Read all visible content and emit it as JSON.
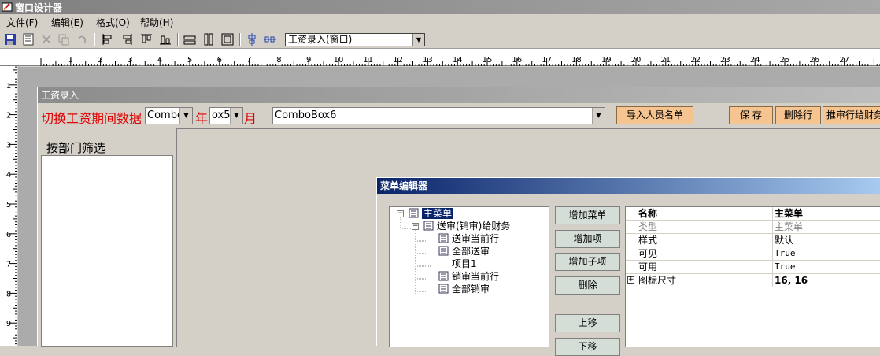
{
  "app": {
    "title": "窗口设计器"
  },
  "menubar": [
    "文件(F)",
    "编辑(E)",
    "格式(O)",
    "帮助(H)"
  ],
  "toolbar": {
    "icons": [
      "save-icon",
      "save-all-icon",
      "cut-icon",
      "copy-icon",
      "undo-icon",
      "align-left-icon",
      "align-right-icon",
      "align-top-icon",
      "align-bottom-icon",
      "same-width-icon",
      "same-height-icon",
      "same-size-icon",
      "center-vertical-icon",
      "center-horizontal-icon"
    ],
    "window_select_value": "工资录入(窗口)"
  },
  "ruler": {
    "h_labels": [
      "1",
      "2",
      "3",
      "4",
      "5",
      "6",
      "7",
      "8",
      "9",
      "10",
      "11",
      "12",
      "13",
      "14",
      "15",
      "16",
      "17",
      "18",
      "19",
      "20",
      "21",
      "22",
      "23",
      "24",
      "25",
      "26",
      "27"
    ],
    "v_labels": [
      "1",
      "2",
      "3",
      "4",
      "5",
      "6",
      "7",
      "8",
      "9"
    ]
  },
  "form": {
    "title": "工资录入",
    "period_label": "切换工资期间数据",
    "combo_year": "Combo",
    "year_label": "年",
    "combo_month": "ox5",
    "month_label": "月",
    "combo6": "ComboBox6",
    "import_button": "导入人员名单",
    "save_button": "保 存",
    "delete_row_button": "删除行",
    "push_button": "推审行给财务",
    "dept_filter_label": "按部门筛选"
  },
  "menu_editor": {
    "title": "菜单编辑器",
    "tree": [
      {
        "label": "主菜单",
        "selected": true
      },
      {
        "label": "送审(销审)给财务"
      },
      {
        "label": "送审当前行"
      },
      {
        "label": "全部送审"
      },
      {
        "label": "项目1"
      },
      {
        "label": "销审当前行"
      },
      {
        "label": "全部销审"
      }
    ],
    "buttons": [
      "增加菜单",
      "增加项",
      "增加子项",
      "删除",
      "上移",
      "下移"
    ],
    "properties": [
      {
        "key": "名称",
        "value": "主菜单",
        "style": "header"
      },
      {
        "key": "类型",
        "value": "主菜单",
        "style": "grey"
      },
      {
        "key": "样式",
        "value": "默认"
      },
      {
        "key": "可见",
        "value": "True",
        "mono": true
      },
      {
        "key": "可用",
        "value": "True",
        "mono": true
      },
      {
        "key": "图标尺寸",
        "value": "16, 16",
        "style": "header-value",
        "expandable": true
      }
    ]
  },
  "colors": {
    "accent_red": "#e00000",
    "dialog_title": "#0a246a",
    "orange_button": "#f5c490"
  }
}
